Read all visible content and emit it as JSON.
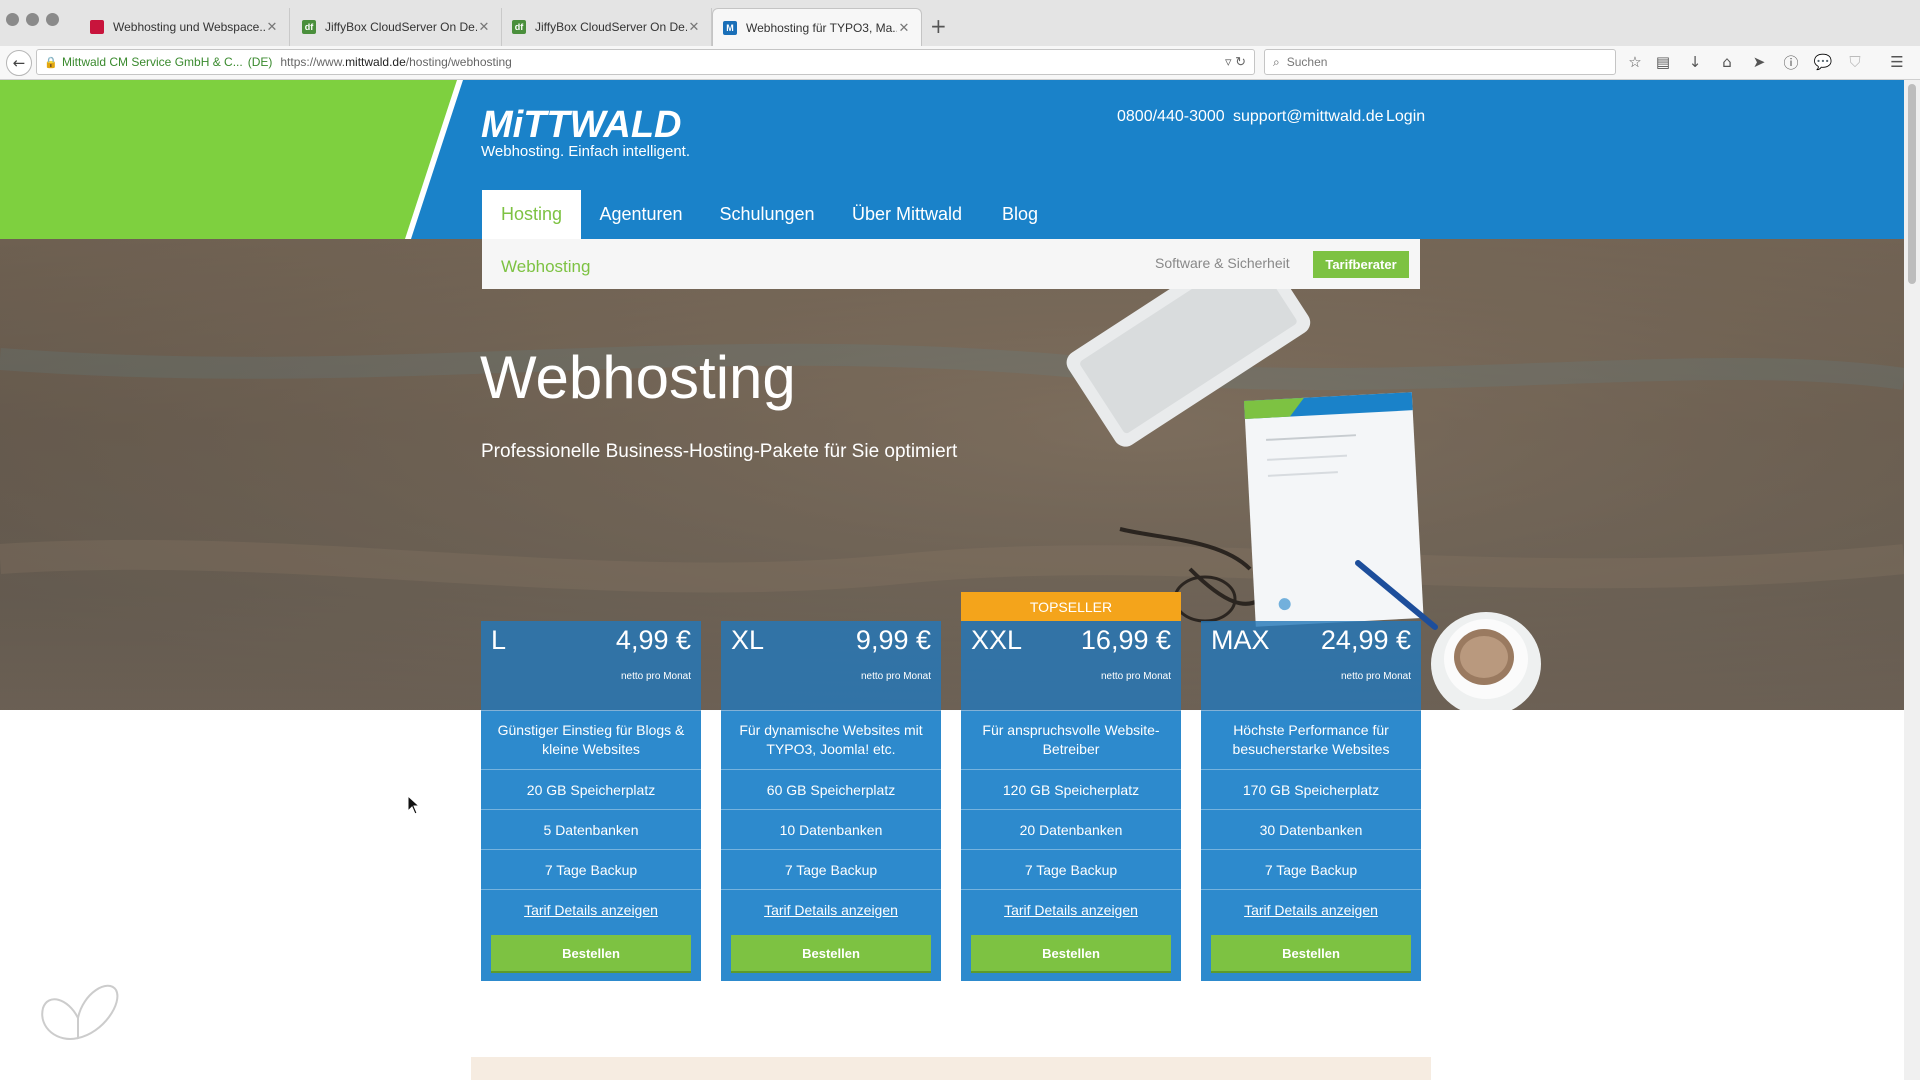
{
  "browser": {
    "tabs": [
      {
        "label": "Webhosting und Webspace...",
        "icon_color": "#c8143c",
        "icon_glyph": ""
      },
      {
        "label": "JiffyBox CloudServer On De...",
        "icon_color": "#4a8f3c",
        "icon_glyph": "df"
      },
      {
        "label": "JiffyBox CloudServer On De...",
        "icon_color": "#4a8f3c",
        "icon_glyph": "df"
      },
      {
        "label": "Webhosting für TYPO3, Ma...",
        "icon_color": "#1a6fb8",
        "icon_glyph": "M"
      }
    ],
    "active_tab": 3,
    "cert_owner": "Mittwald CM Service GmbH & C...",
    "cert_country": "(DE)",
    "url_prefix": "https://www.",
    "url_host": "mittwald.de",
    "url_path": "/hosting/webhosting",
    "search_placeholder": "Suchen"
  },
  "header": {
    "logo": "MiTTWALD",
    "tagline": "Webhosting. Einfach intelligent.",
    "phone": "0800/440-3000",
    "email": "support@mittwald.de",
    "login": "Login",
    "nav": [
      "Hosting",
      "Agenturen",
      "Schulungen",
      "Über Mittwald",
      "Blog"
    ],
    "active_nav": 0
  },
  "subnav": {
    "current": "Webhosting",
    "secondary": "Software & Sicherheit",
    "cta": "Tarifberater"
  },
  "hero": {
    "title": "Webhosting",
    "subtitle": "Professionelle Business-Hosting-Pakete für Sie optimiert"
  },
  "plans": [
    {
      "name": "L",
      "price": "4,99 €",
      "net": "netto pro Monat",
      "desc": "Günstiger Einstieg für Blogs & kleine Websites",
      "storage": "20 GB Speicherplatz",
      "db": "5 Datenbanken",
      "backup": "7 Tage Backup",
      "details": "Tarif Details anzeigen",
      "order": "Bestellen",
      "badge": ""
    },
    {
      "name": "XL",
      "price": "9,99 €",
      "net": "netto pro Monat",
      "desc": "Für dynamische Websites mit TYPO3, Joomla! etc.",
      "storage": "60 GB Speicherplatz",
      "db": "10 Datenbanken",
      "backup": "7 Tage Backup",
      "details": "Tarif Details anzeigen",
      "order": "Bestellen",
      "badge": ""
    },
    {
      "name": "XXL",
      "price": "16,99 €",
      "net": "netto pro Monat",
      "desc": "Für anspruchsvolle Website-Betreiber",
      "storage": "120 GB Speicherplatz",
      "db": "20 Datenbanken",
      "backup": "7 Tage Backup",
      "details": "Tarif Details anzeigen",
      "order": "Bestellen",
      "badge": "TOPSELLER"
    },
    {
      "name": "MAX",
      "price": "24,99 €",
      "net": "netto pro Monat",
      "desc": "Höchste Performance für besucherstarke Websites",
      "storage": "170 GB Speicherplatz",
      "db": "30 Datenbanken",
      "backup": "7 Tage Backup",
      "details": "Tarif Details anzeigen",
      "order": "Bestellen",
      "badge": ""
    }
  ],
  "colors": {
    "brand_blue": "#1a82c9",
    "brand_green": "#7dc242",
    "topseller_orange": "#f4a41b"
  }
}
